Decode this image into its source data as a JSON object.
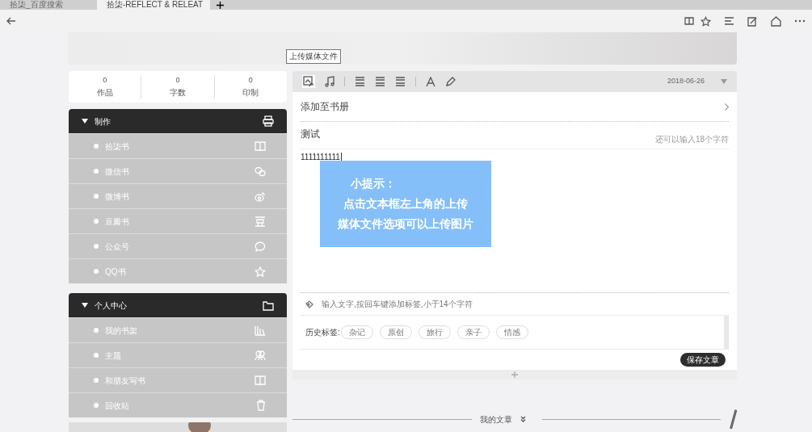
{
  "browser": {
    "tabs": [
      {
        "title": "拾柒_百度搜索",
        "selected": false
      },
      {
        "title": "拾柒-REFLECT & RELEAT",
        "selected": true
      }
    ]
  },
  "tooltip": "上传媒体文件",
  "stats": [
    {
      "value": "0",
      "label": "作品"
    },
    {
      "value": "0",
      "label": "字数"
    },
    {
      "value": "0",
      "label": "印制"
    }
  ],
  "sections": [
    {
      "title": "制作",
      "expanded": true,
      "items": [
        {
          "label": "拾柒书"
        },
        {
          "label": "微信书"
        },
        {
          "label": "微博书"
        },
        {
          "label": "豆瓣书"
        },
        {
          "label": "公众号"
        },
        {
          "label": "QQ书"
        }
      ]
    },
    {
      "title": "个人中心",
      "expanded": true,
      "items": [
        {
          "label": "我的书架"
        },
        {
          "label": "主题"
        },
        {
          "label": "和朋友写书"
        },
        {
          "label": "回收站"
        }
      ]
    }
  ],
  "editor": {
    "date": "2018-06-26",
    "album": "添加至书册",
    "title": "测试",
    "title_hint": "还可以输入18个字符",
    "body": "1111111111",
    "tag_placeholder": "输入文字,按回车键添加标签,小于14个字符",
    "history_label": "历史标签:",
    "tags": [
      "杂记",
      "原创",
      "旅行",
      "亲子",
      "情感"
    ],
    "save": "保存文章"
  },
  "callout": {
    "heading": "小提示：",
    "lines": [
      "点击文本框左上角的上传",
      "媒体文件选项可以上传图片"
    ]
  },
  "articles": {
    "label": "我的文章"
  }
}
